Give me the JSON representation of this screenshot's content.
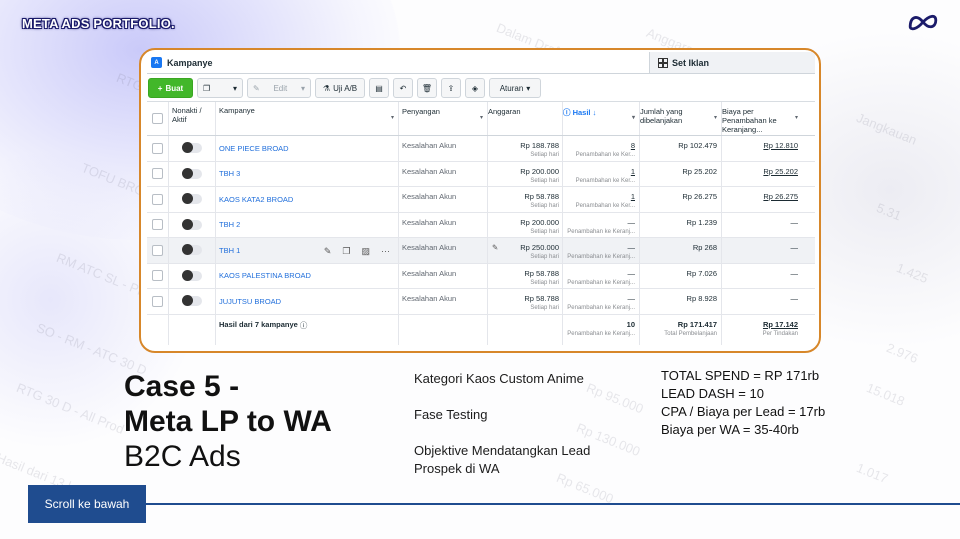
{
  "brand": "META ADS PORTFOLIO.",
  "colors": {
    "accent_orange": "#d7872a",
    "create_green": "#42b72a",
    "link_blue": "#216fdb",
    "navy": "#1f4c8f"
  },
  "icons": [
    "meta-logo-icon",
    "plus-icon",
    "copy-icon",
    "pencil-icon",
    "flask-icon",
    "trash-icon",
    "undo-icon",
    "tag-icon",
    "grid-icon",
    "info-icon"
  ],
  "tabs": {
    "campaign": "Kampanye",
    "campaign_badge": "A",
    "adset": "Set Iklan"
  },
  "toolbar": {
    "create": "Buat",
    "edit": "Edit",
    "ab_test": "Uji A/B",
    "rules": "Aturan"
  },
  "table": {
    "headers": {
      "toggle": "Nonakti / Aktif",
      "name": "Kampanye",
      "delivery": "Penyangan",
      "budget": "Anggaran",
      "results": "Hasil ↓",
      "spent_l1": "Jumlah yang",
      "spent_l2": "dibelanjakan",
      "cpr_l1": "Biaya per",
      "cpr_l2": "Penambahan ke",
      "cpr_l3": "Keranjang..."
    },
    "rows": [
      {
        "name": "ONE PIECE BROAD",
        "delivery": "Kesalahan Akun",
        "budget": "Rp 188.788",
        "budget_sub": "Setiap hari",
        "result": "8",
        "result_sub": "Penambahan ke Ker...",
        "spent": "Rp 102.479",
        "cpr": "Rp 12.810"
      },
      {
        "name": "TBH 3",
        "delivery": "Kesalahan Akun",
        "budget": "Rp 200.000",
        "budget_sub": "Setiap hari",
        "result": "1",
        "result_sub": "Penambahan ke Ker...",
        "spent": "Rp 25.202",
        "cpr": "Rp 25.202"
      },
      {
        "name": "KAOS KATA2 BROAD",
        "delivery": "Kesalahan Akun",
        "budget": "Rp 58.788",
        "budget_sub": "Setiap hari",
        "result": "1",
        "result_sub": "Penambahan ke Ker...",
        "spent": "Rp 26.275",
        "cpr": "Rp 26.275"
      },
      {
        "name": "TBH 2",
        "delivery": "Kesalahan Akun",
        "budget": "Rp 200.000",
        "budget_sub": "Setiap hari",
        "result": "—",
        "result_sub": "Penambahan ke Keranj...",
        "spent": "Rp 1.239",
        "cpr": "—"
      },
      {
        "name": "TBH 1",
        "delivery": "Kesalahan Akun",
        "budget": "Rp 250.000",
        "budget_sub": "Setiap hari",
        "result": "—",
        "result_sub": "Penambahan ke Keranj...",
        "spent": "Rp 268",
        "cpr": "—"
      },
      {
        "name": "KAOS PALESTINA BROAD",
        "delivery": "Kesalahan Akun",
        "budget": "Rp 58.788",
        "budget_sub": "Setiap hari",
        "result": "—",
        "result_sub": "Penambahan ke Keranj...",
        "spent": "Rp 7.026",
        "cpr": "—"
      },
      {
        "name": "JUJUTSU BROAD",
        "delivery": "Kesalahan Akun",
        "budget": "Rp 58.788",
        "budget_sub": "Setiap hari",
        "result": "—",
        "result_sub": "Penambahan ke Keranj...",
        "spent": "Rp 8.928",
        "cpr": "—"
      }
    ],
    "footer": {
      "label": "Hasil dari 7 kampanye",
      "result": "10",
      "result_sub": "Penambahan ke Keranj...",
      "spent": "Rp 171.417",
      "spent_sub": "Total Pembelanjaan",
      "cpr": "Rp 17.142",
      "cpr_sub": "Per Tindakan"
    }
  },
  "case": {
    "line1": "Case 5 -",
    "line2": "Meta LP to WA",
    "line3": "B2C Ads"
  },
  "details": {
    "category": "Kategori Kaos Custom Anime",
    "phase": "Fase Testing",
    "objective_l1": "Objektive Mendatangkan Lead",
    "objective_l2": "Prospek di WA"
  },
  "stats": {
    "total_spend": "TOTAL SPEND = RP 171rb",
    "lead_dash": "LEAD DASH = 10",
    "cpa": "CPA / Biaya per Lead = 17rb",
    "per_wa": "Biaya per WA = 35-40rb"
  },
  "scroll_button": "Scroll ke bawah"
}
